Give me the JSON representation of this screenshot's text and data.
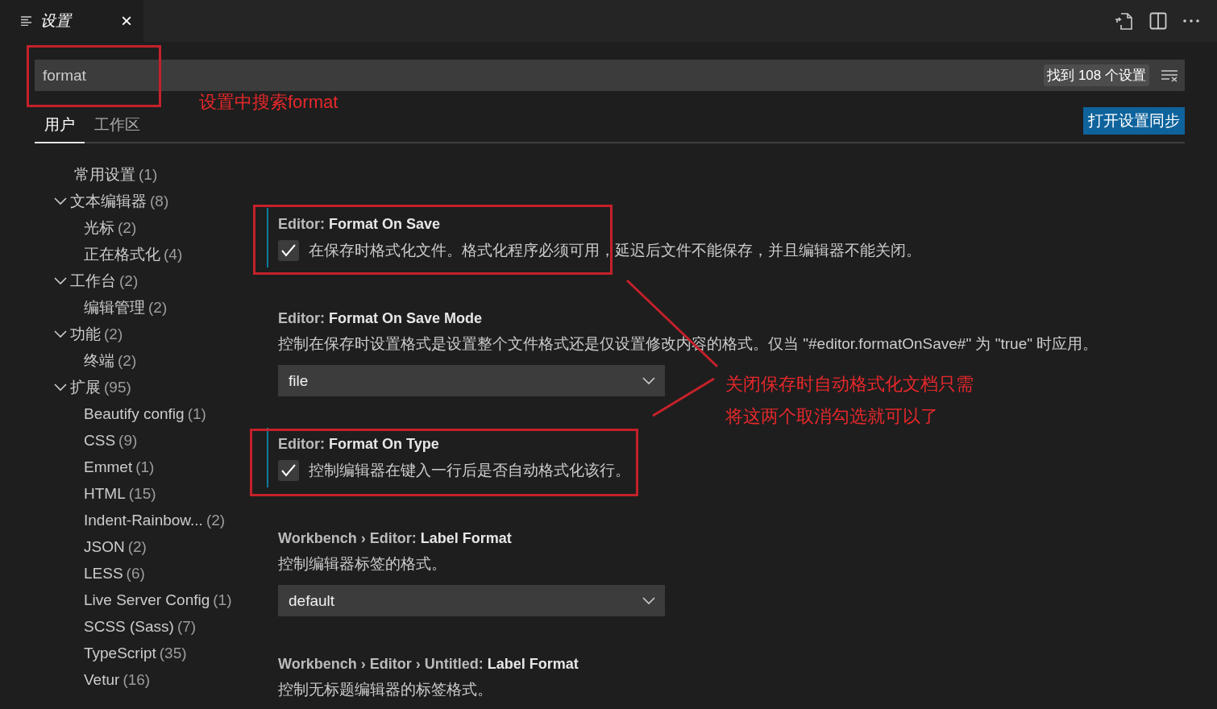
{
  "tab": {
    "title": "设置",
    "close": "×"
  },
  "search": {
    "value": "format",
    "result_count": "找到 108 个设置"
  },
  "scopes": [
    {
      "label": "用户",
      "selected": true
    },
    {
      "label": "工作区",
      "selected": false
    }
  ],
  "sync_button": "打开设置同步",
  "tree": [
    {
      "label": "常用设置",
      "count": "(1)"
    },
    {
      "label": "文本编辑器",
      "count": "(8)",
      "expanded": true,
      "children": [
        {
          "label": "光标",
          "count": "(2)"
        },
        {
          "label": "正在格式化",
          "count": "(4)"
        }
      ]
    },
    {
      "label": "工作台",
      "count": "(2)",
      "expanded": true,
      "children": [
        {
          "label": "编辑管理",
          "count": "(2)"
        }
      ]
    },
    {
      "label": "功能",
      "count": "(2)",
      "expanded": true,
      "children": [
        {
          "label": "终端",
          "count": "(2)"
        }
      ]
    },
    {
      "label": "扩展",
      "count": "(95)",
      "expanded": true,
      "children": [
        {
          "label": "Beautify config",
          "count": "(1)"
        },
        {
          "label": "CSS",
          "count": "(9)"
        },
        {
          "label": "Emmet",
          "count": "(1)"
        },
        {
          "label": "HTML",
          "count": "(15)"
        },
        {
          "label": "Indent-Rainbow...",
          "count": "(2)"
        },
        {
          "label": "JSON",
          "count": "(2)"
        },
        {
          "label": "LESS",
          "count": "(6)"
        },
        {
          "label": "Live Server Config",
          "count": "(1)"
        },
        {
          "label": "SCSS (Sass)",
          "count": "(7)"
        },
        {
          "label": "TypeScript",
          "count": "(35)"
        },
        {
          "label": "Vetur",
          "count": "(16)"
        }
      ]
    }
  ],
  "settings": [
    {
      "kind": "checkbox",
      "category": "Editor: ",
      "name": "Format On Save",
      "modified": true,
      "checked": true,
      "description": "在保存时格式化文件。格式化程序必须可用，延迟后文件不能保存，并且编辑器不能关闭。"
    },
    {
      "kind": "dropdown",
      "category": "Editor: ",
      "name": "Format On Save Mode",
      "modified": false,
      "description": "控制在保存时设置格式是设置整个文件格式还是仅设置修改内容的格式。仅当 \"#editor.formatOnSave#\" 为 \"true\" 时应用。",
      "value": "file"
    },
    {
      "kind": "checkbox",
      "category": "Editor: ",
      "name": "Format On Type",
      "modified": true,
      "checked": true,
      "description": "控制编辑器在键入一行后是否自动格式化该行。"
    },
    {
      "kind": "dropdown",
      "category": "Workbench › Editor: ",
      "name": "Label Format",
      "modified": false,
      "description": "控制编辑器标签的格式。",
      "value": "default"
    },
    {
      "kind": "plain",
      "category": "Workbench › Editor › Untitled: ",
      "name": "Label Format",
      "modified": false,
      "description": "控制无标题编辑器的标签格式。"
    }
  ],
  "annotations": [
    {
      "text": "设置中搜索format"
    },
    {
      "text": "关闭保存时自动格式化文档只需"
    },
    {
      "text": "将这两个取消勾选就可以了"
    }
  ]
}
